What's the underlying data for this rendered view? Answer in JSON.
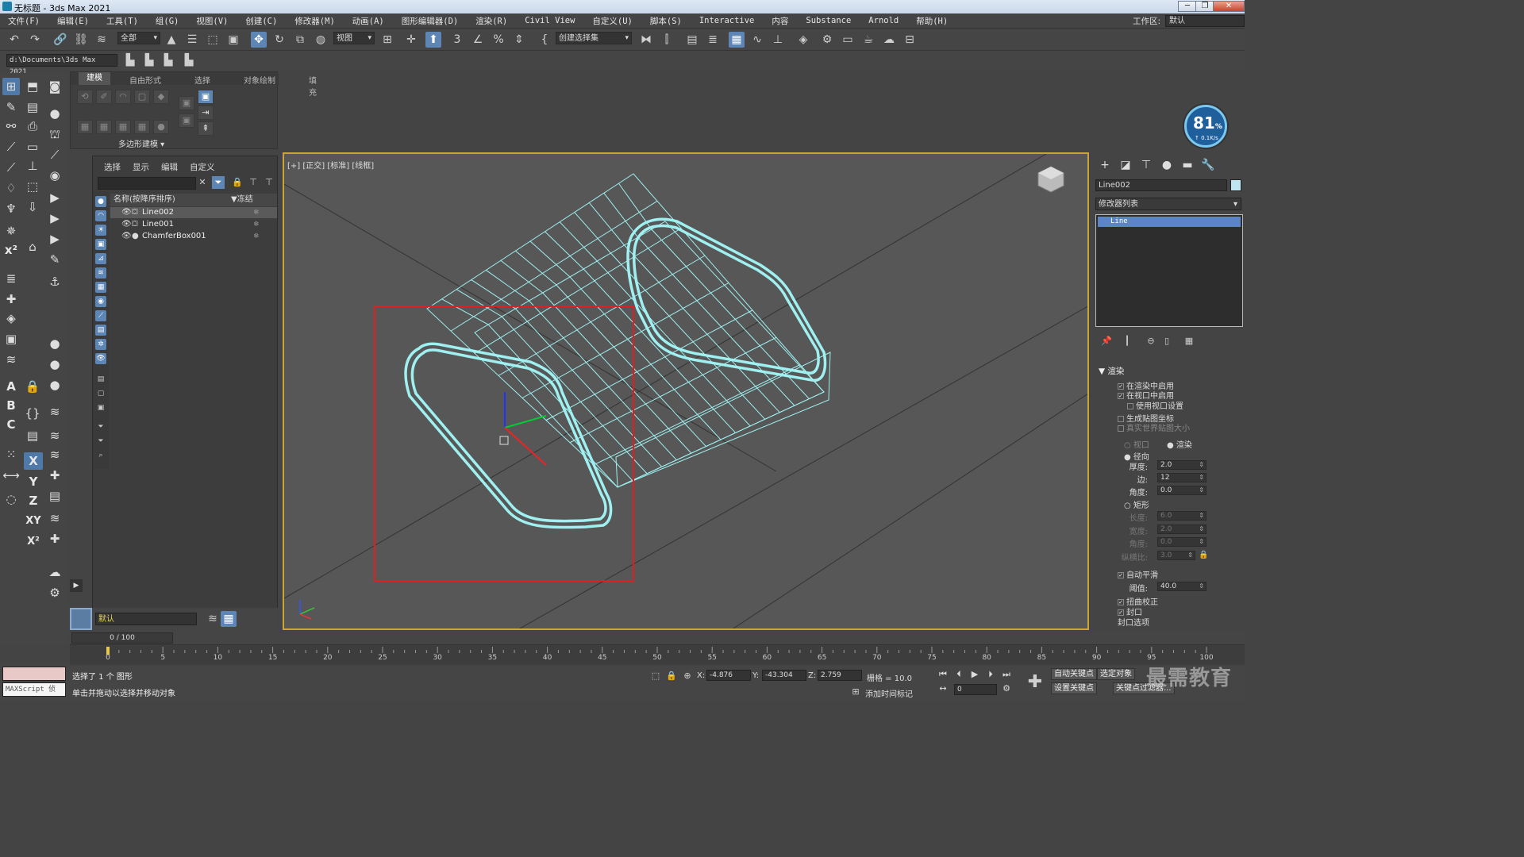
{
  "window": {
    "title": "无标题 - 3ds Max 2021",
    "buttons": [
      "─",
      "❐",
      "✕"
    ]
  },
  "menubar": {
    "items": [
      "文件(F)",
      "编辑(E)",
      "工具(T)",
      "组(G)",
      "视图(V)",
      "创建(C)",
      "修改器(M)",
      "动画(A)",
      "图形编辑器(D)",
      "渲染(R)",
      "Civil View",
      "自定义(U)",
      "脚本(S)",
      "Interactive",
      "内容",
      "Substance",
      "Arnold",
      "帮助(H)"
    ],
    "workspace_label": "工作区:",
    "workspace_value": "默认"
  },
  "toolbar": {
    "filter_dropdown": "全部",
    "refcoord_dropdown": "视图",
    "selset_dropdown": "创建选择集"
  },
  "project": {
    "path": "d:\\Documents\\3ds Max 2021"
  },
  "ribbon": {
    "tabs": [
      "建模",
      "自由形式",
      "选择",
      "对象绘制",
      "填充"
    ],
    "panel_label": "多边形建模 ▾"
  },
  "explorer": {
    "menu": [
      "选择",
      "显示",
      "编辑",
      "自定义"
    ],
    "col_name": "名称(按降序排序)",
    "col_frozen": "▼冻结",
    "rows": [
      {
        "name": "Line002"
      },
      {
        "name": "Line001"
      },
      {
        "name": "ChamferBox001"
      }
    ]
  },
  "layer": {
    "value": "默认"
  },
  "viewport": {
    "label": "[+] [正交] [标准] [线框]",
    "wire_color": "#9ff0f0",
    "select_rect_color": "#e02020"
  },
  "gauge": {
    "percent": "81",
    "percent_symbol": "%",
    "rate": "↑ 0.1K/s"
  },
  "cmdpanel": {
    "object_name": "Line002",
    "modifier_list": "修改器列表",
    "stack_item": "Line",
    "rollout_title": "▼ 渲染",
    "opts": {
      "render_enable": "在渲染中启用",
      "viewport_enable": "在视口中启用",
      "use_vp_settings": "使用视口设置",
      "gen_map_coords": "生成贴图坐标",
      "real_world": "真实世界贴图大小",
      "vp_radio": "视口",
      "render_radio": "渲染",
      "radial": "径向",
      "thickness_lbl": "厚度:",
      "thickness": "2.0",
      "sides_lbl": "边:",
      "sides": "12",
      "angle_lbl": "角度:",
      "angle": "0.0",
      "rect": "矩形",
      "length_lbl": "长度:",
      "length": "6.0",
      "width_lbl": "宽度:",
      "width": "2.0",
      "angle2_lbl": "角度:",
      "angle2": "0.0",
      "aspect_lbl": "纵横比:",
      "aspect": "3.0",
      "auto_smooth": "自动平滑",
      "threshold_lbl": "阈值:",
      "threshold": "40.0",
      "twist": "扭曲校正",
      "cap": "封口",
      "cap_opts": "封口选项"
    }
  },
  "timeline": {
    "frame": "0 / 100",
    "ticks": [
      "0",
      "5",
      "10",
      "15",
      "20",
      "25",
      "30",
      "35",
      "40",
      "45",
      "50",
      "55",
      "60",
      "65",
      "70",
      "75",
      "80",
      "85",
      "90",
      "95",
      "100"
    ]
  },
  "status": {
    "maxscript": "MAXScript 侦",
    "selected": "选择了 1 个 图形",
    "prompt": "单击并拖动以选择并移动对象",
    "x_lbl": "X:",
    "x": "-4.876",
    "y_lbl": "Y:",
    "y": "-43.304",
    "z_lbl": "Z:",
    "z": "2.759",
    "grid": "栅格 = 10.0",
    "add_tag": "添加时间标记",
    "auto_key": "自动关键点",
    "set_key": "设置关键点",
    "sel_obj": "选定对象",
    "key_filter": "关键点过滤器...",
    "frame_field": "0"
  },
  "watermark": "最需教育"
}
